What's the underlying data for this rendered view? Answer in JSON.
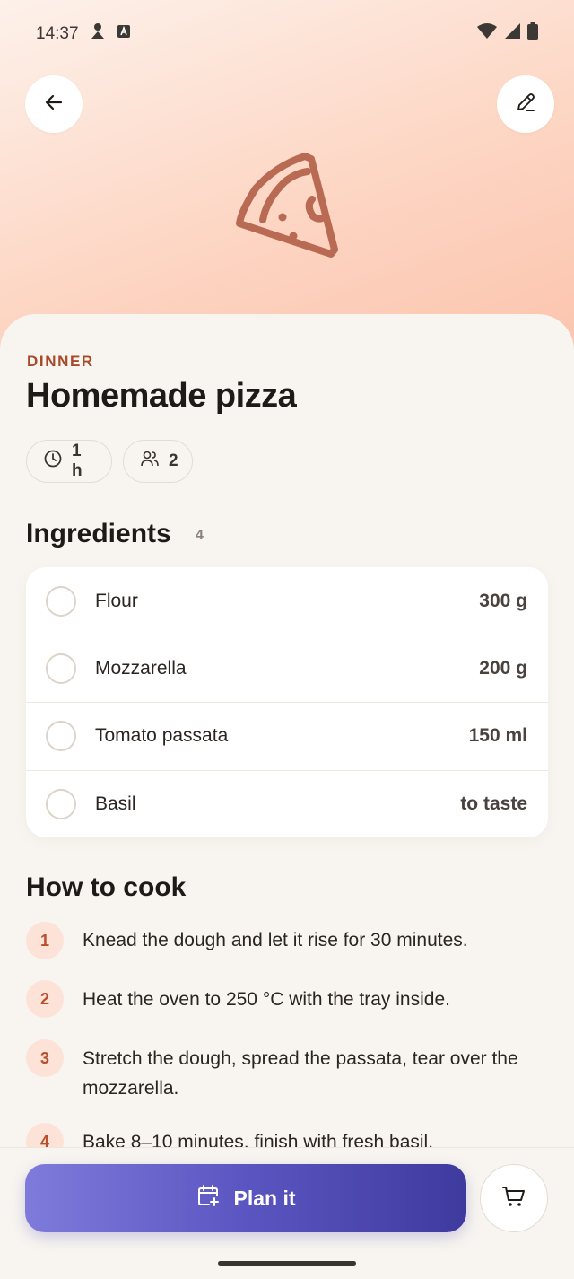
{
  "status_bar": {
    "time": "14:37"
  },
  "recipe": {
    "category": "DINNER",
    "title": "Homemade pizza",
    "time": "1 h",
    "servings": "2"
  },
  "ingredients": {
    "heading": "Ingredients",
    "count": "4",
    "items": [
      {
        "name": "Flour",
        "qty": "300 g"
      },
      {
        "name": "Mozzarella",
        "qty": "200 g"
      },
      {
        "name": "Tomato passata",
        "qty": "150 ml"
      },
      {
        "name": "Basil",
        "qty": "to taste"
      }
    ]
  },
  "steps": {
    "heading": "How to cook",
    "items": [
      {
        "num": "1",
        "text": "Knead the dough and let it rise for 30 minutes."
      },
      {
        "num": "2",
        "text": "Heat the oven to 250 °C with the tray inside."
      },
      {
        "num": "3",
        "text": "Stretch the dough, spread the passata, tear over the mozzarella."
      },
      {
        "num": "4",
        "text": "Bake 8–10 minutes, finish with fresh basil."
      }
    ]
  },
  "actions": {
    "plan_label": "Plan it"
  },
  "icons": {
    "back": "arrow-left-icon",
    "edit": "pencil-icon",
    "hero": "pizza-slice-icon",
    "time": "clock-icon",
    "servings": "people-icon",
    "plan": "calendar-plus-icon",
    "cart": "cart-icon"
  },
  "colors": {
    "accent": "#a84a2a",
    "hero_gradient_start": "#fdf1ea",
    "hero_gradient_end": "#fbc4ad",
    "primary_button_start": "#7f7bdb",
    "primary_button_end": "#3f3a9e",
    "step_badge": "#fde2d7"
  }
}
